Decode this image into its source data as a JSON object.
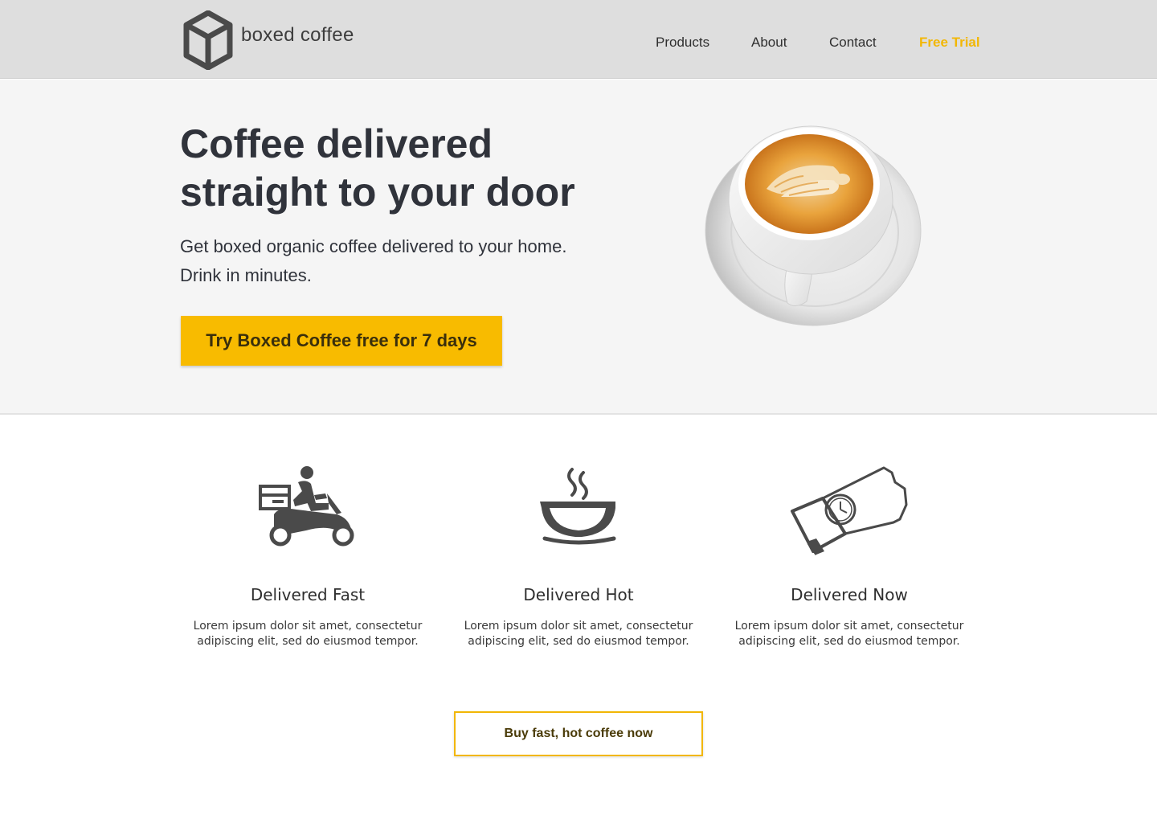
{
  "brand": {
    "name": "boxed coffee",
    "logo_icon": "cube-icon"
  },
  "nav": {
    "items": [
      "Products",
      "About",
      "Contact"
    ],
    "cta": "Free Trial"
  },
  "hero": {
    "title": "Coffee delivered straight to your door",
    "subtitle_line1": "Get boxed organic coffee delivered to your home.",
    "subtitle_line2": "Drink in minutes.",
    "cta": "Try Boxed Coffee free for 7 days",
    "image": "latte-cup-image"
  },
  "features": [
    {
      "icon": "delivery-scooter-icon",
      "title": "Delivered Fast",
      "text": "Lorem ipsum dolor sit amet, consectetur adipiscing elit, sed do eiusmod tempor."
    },
    {
      "icon": "hot-coffee-icon",
      "title": "Delivered Hot",
      "text": "Lorem ipsum dolor sit amet, consectetur adipiscing elit, sed do eiusmod tempor."
    },
    {
      "icon": "wristwatch-icon",
      "title": "Delivered Now",
      "text": "Lorem ipsum dolor sit amet, consectetur adipiscing elit, sed do eiusmod tempor."
    }
  ],
  "buy_cta": "Buy fast, hot coffee now",
  "colors": {
    "accent": "#f8bb00",
    "nav_accent": "#f2b705",
    "header_bg": "#dedede",
    "hero_bg": "#f5f5f5",
    "text_dark": "#30333b",
    "icon_gray": "#4a4a4a"
  }
}
